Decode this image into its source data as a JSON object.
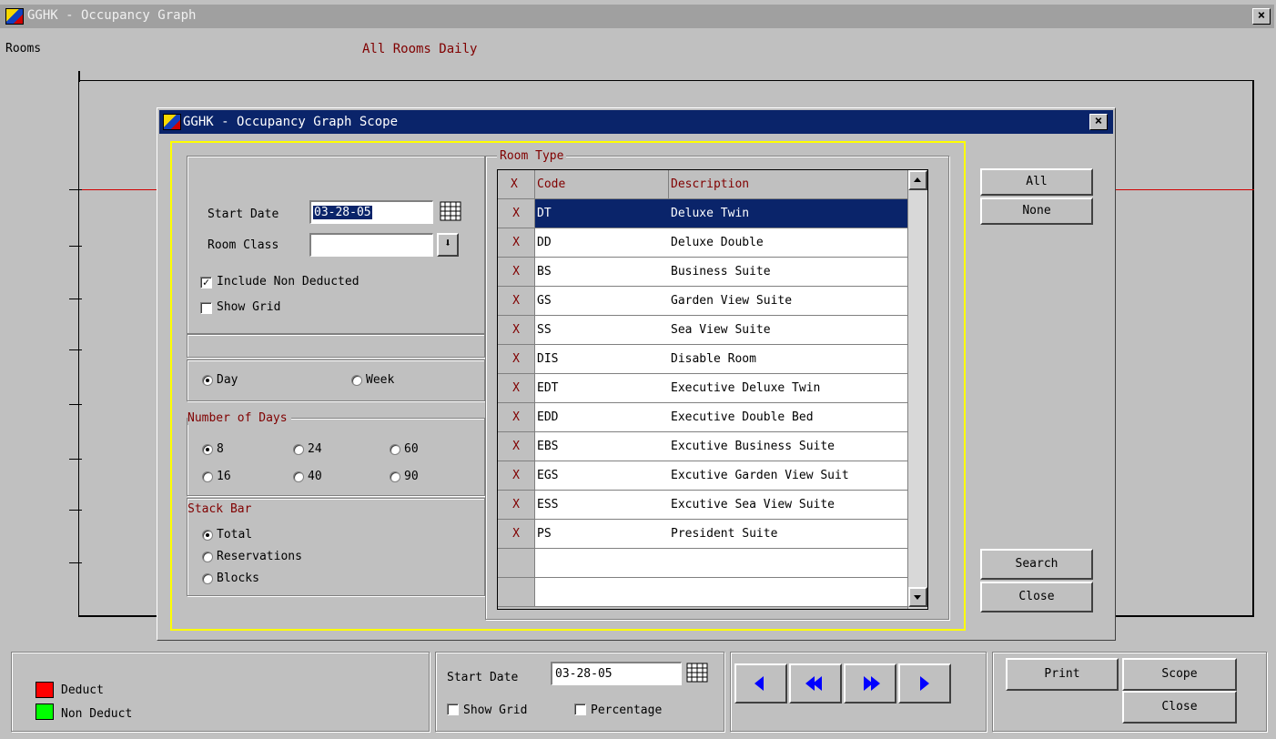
{
  "main_window": {
    "title": "GGHK - Occupancy Graph",
    "y_label": "Rooms",
    "graph_title": "All Rooms Daily"
  },
  "dialog": {
    "title": "GGHK - Occupancy Graph Scope",
    "start_date_label": "Start Date",
    "start_date_value": "03-28-05",
    "room_class_label": "Room Class",
    "room_class_value": "",
    "include_non_deducted_label": "Include Non Deducted",
    "include_non_deducted_checked": true,
    "show_grid_label": "Show Grid",
    "show_grid_checked": false,
    "day_label": "Day",
    "week_label": "Week",
    "view_selected": "Day",
    "number_of_days_label": "Number of Days",
    "days_options": [
      "8",
      "24",
      "60",
      "16",
      "40",
      "90"
    ],
    "days_selected": "8",
    "stack_bar_label": "Stack Bar",
    "stack_options": [
      "Total",
      "Reservations",
      "Blocks"
    ],
    "stack_selected": "Total",
    "room_type_label": "Room Type",
    "table": {
      "columns": [
        "X",
        "Code",
        "Description"
      ],
      "rows": [
        {
          "x": "X",
          "code": "DT",
          "desc": "Deluxe Twin"
        },
        {
          "x": "X",
          "code": "DD",
          "desc": "Deluxe Double"
        },
        {
          "x": "X",
          "code": "BS",
          "desc": "Business Suite"
        },
        {
          "x": "X",
          "code": "GS",
          "desc": "Garden View Suite"
        },
        {
          "x": "X",
          "code": "SS",
          "desc": "Sea View Suite"
        },
        {
          "x": "X",
          "code": "DIS",
          "desc": "Disable Room"
        },
        {
          "x": "X",
          "code": "EDT",
          "desc": "Executive Deluxe Twin"
        },
        {
          "x": "X",
          "code": "EDD",
          "desc": "Executive Double Bed"
        },
        {
          "x": "X",
          "code": "EBS",
          "desc": "Excutive Business Suite"
        },
        {
          "x": "X",
          "code": "EGS",
          "desc": "Excutive Garden View Suit"
        },
        {
          "x": "X",
          "code": "ESS",
          "desc": "Excutive Sea View Suite"
        },
        {
          "x": "X",
          "code": "PS",
          "desc": "President Suite"
        }
      ]
    },
    "all_button": "All",
    "none_button": "None",
    "search_button": "Search",
    "close_button": "Close"
  },
  "bottom_bar": {
    "legend": [
      {
        "label": "Deduct",
        "color": "#ff0000"
      },
      {
        "label": "Non Deduct",
        "color": "#00ff00"
      }
    ],
    "start_date_label": "Start Date",
    "start_date_value": "03-28-05",
    "show_grid_label": "Show Grid",
    "percentage_label": "Percentage",
    "print_button": "Print",
    "scope_button": "Scope",
    "close_button": "Close"
  },
  "colors": {
    "accent_selection": "#0a246a",
    "dialog_title": "#0a246a",
    "focus_border": "#ffff00",
    "label_red": "#800000"
  }
}
